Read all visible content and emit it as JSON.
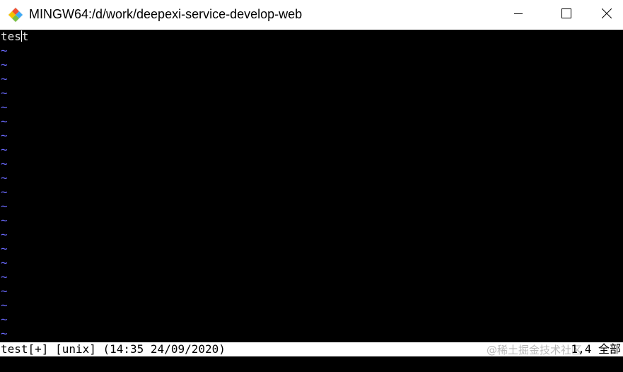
{
  "window": {
    "title": "MINGW64:/d/work/deepexi-service-develop-web",
    "icon": "git-bash-icon",
    "controls": [
      "minimize-icon",
      "maximize-icon",
      "close-icon"
    ]
  },
  "editor": {
    "first_line_before_cursor": "tes",
    "first_line_after_cursor": "t",
    "empty_line_marker": "~",
    "empty_line_count": 21
  },
  "statusline": {
    "left": "test[+] [unix] (14:35 24/09/2020)",
    "right": "1,4 全部",
    "watermark": "@稀土掘金技术社区"
  },
  "colors": {
    "titlebar_bg": "#ffffff",
    "terminal_bg": "#000000",
    "tilde": "#6a6aff",
    "statusline_bg": "#ffffff",
    "statusline_fg": "#000000"
  }
}
